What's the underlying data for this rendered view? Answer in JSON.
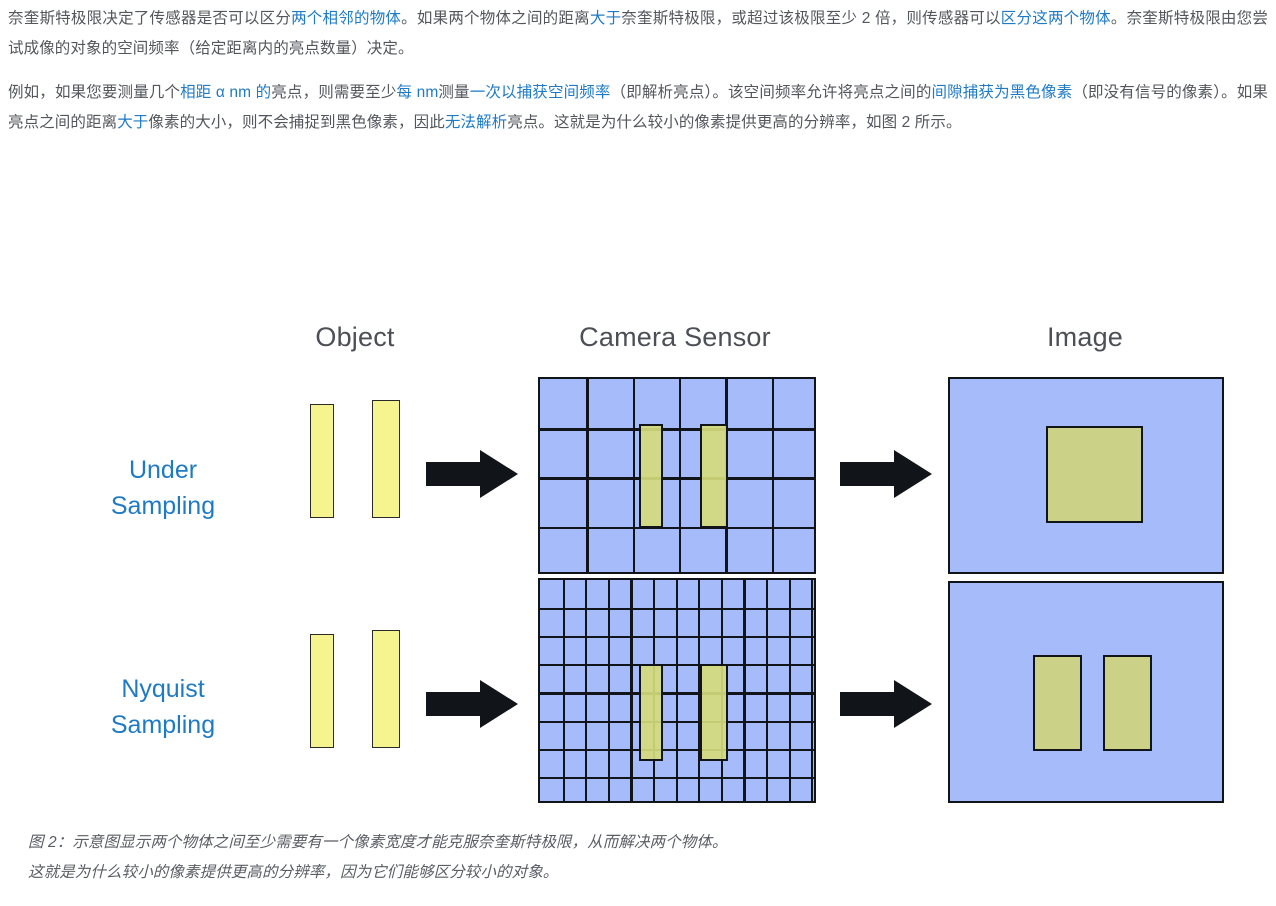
{
  "paragraphs": [
    {
      "id": "p1",
      "runs": [
        {
          "t": "奈奎斯特极限决定了传感器是否可以区分",
          "link": false
        },
        {
          "t": "两个相邻的物体",
          "link": true
        },
        {
          "t": "。如果两个物体之间的距离",
          "link": false
        },
        {
          "t": "大于",
          "link": true
        },
        {
          "t": "奈奎斯特极限，或超过该极限至少 2 倍，则传感器可以",
          "link": false
        },
        {
          "t": "区分这两个物体",
          "link": true
        },
        {
          "t": "。奈奎斯特极限由您尝试成像的对象的空间频率（给定距离内的亮点数量）决定。",
          "link": false
        }
      ]
    },
    {
      "id": "p2",
      "runs": [
        {
          "t": "例如，如果您要测量几个",
          "link": false
        },
        {
          "t": "相距 α nm 的",
          "link": true
        },
        {
          "t": "亮点，则需要至少",
          "link": false
        },
        {
          "t": "每 nm",
          "link": true
        },
        {
          "t": "测量",
          "link": false
        },
        {
          "t": "一次以捕获空间频率",
          "link": true
        },
        {
          "t": "（即解析亮点）。该空间频率允许将亮点之间的",
          "link": false
        },
        {
          "t": "间隙捕获为黑色像素",
          "link": true
        },
        {
          "t": "（即没有信号的像素）。如果亮点之间的距离",
          "link": false
        },
        {
          "t": "大于",
          "link": true
        },
        {
          "t": "像素的大小，则不会捕捉到黑色像素，因此",
          "link": false
        },
        {
          "t": "无法解析",
          "link": true
        },
        {
          "t": "亮点。这就是为什么较小的像素提供更高的分辨率，如图 2 所示。",
          "link": false
        }
      ]
    }
  ],
  "figure": {
    "column_headings": {
      "object": "Object",
      "sensor": "Camera Sensor",
      "image": "Image"
    },
    "rows": [
      {
        "label_line1": "Under",
        "label_line2": "Sampling"
      },
      {
        "label_line1": "Nyquist",
        "label_line2": "Sampling"
      }
    ],
    "colors": {
      "sensor_fill": "#a6bbfa",
      "object_fill": "#f6f48f",
      "signal_fill": "#cbd288",
      "outline": "#111418",
      "link_blue": "#1f7ac4",
      "label_blue": "#1f7ac4",
      "body_text": "#53565c"
    },
    "grids": {
      "under_sampling": {
        "cols": 6,
        "rows": 4
      },
      "nyquist_sampling": {
        "cols": 12,
        "rows": 8
      }
    },
    "image_result": {
      "under_sampling": "one merged block",
      "nyquist_sampling": "two separate blocks"
    }
  },
  "caption": {
    "line1": "图 2：示意图显示两个物体之间至少需要有一个像素宽度才能克服奈奎斯特极限，从而解决两个物体。",
    "line2": "这就是为什么较小的像素提供更高的分辨率，因为它们能够区分较小的对象。"
  }
}
